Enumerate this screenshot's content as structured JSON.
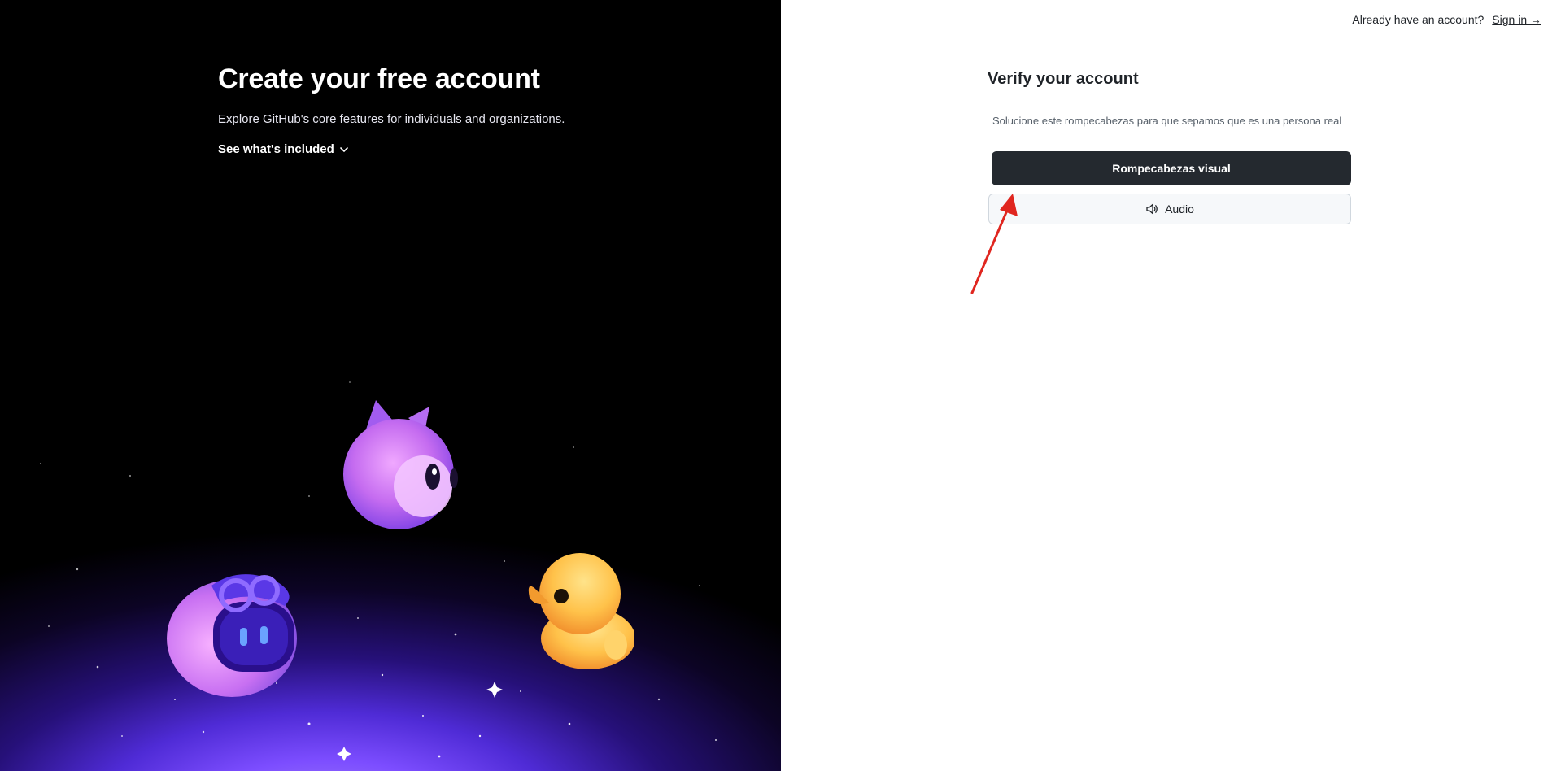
{
  "hero": {
    "title": "Create your free account",
    "subtitle": "Explore GitHub's core features for individuals and organizations.",
    "toggle_label": "See what's included",
    "toggle_icon": "chevron-down-icon",
    "mascots": [
      "mona-cat-mascot",
      "copilot-robot-mascot",
      "rubber-duck-mascot"
    ]
  },
  "header": {
    "prompt": "Already have an account?",
    "signin_label": "Sign in →"
  },
  "verify": {
    "title": "Verify your account",
    "description": "Solucione este rompecabezas para que sepamos que es una persona real",
    "visual_button": "Rompecabezas visual",
    "audio_button": "Audio",
    "audio_icon": "speaker-icon"
  },
  "colors": {
    "primary_button": "#24292f",
    "annotation_arrow": "#e0261f"
  }
}
